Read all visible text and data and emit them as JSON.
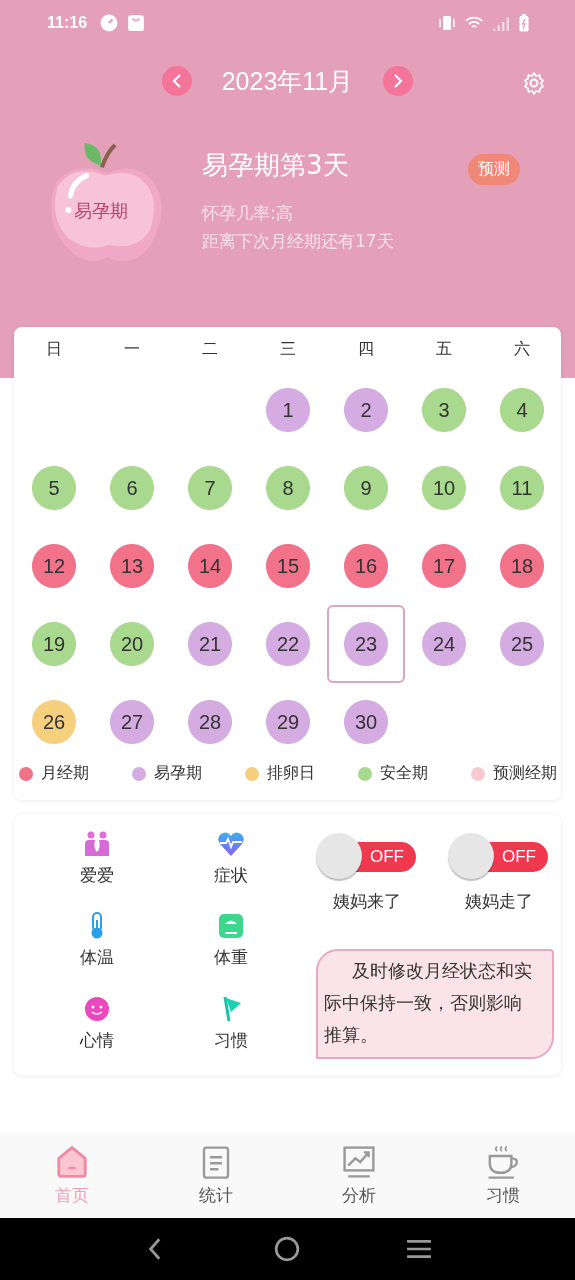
{
  "status_bar": {
    "time": "11:16"
  },
  "header": {
    "month": "2023年11月",
    "phase_badge": "易孕期",
    "phase_title": "易孕期第3天",
    "forecast_tag": "预测",
    "lines": [
      "怀孕几率:高",
      "距离下次月经期还有17天"
    ]
  },
  "calendar": {
    "weekdays": [
      "日",
      "一",
      "二",
      "三",
      "四",
      "五",
      "六"
    ],
    "weeks": [
      [
        {
          "kind": "blank"
        },
        {
          "kind": "blank"
        },
        {
          "kind": "blank"
        },
        {
          "kind": "day",
          "day": "1",
          "color": "#d4ace2",
          "selected": false
        },
        {
          "kind": "day",
          "day": "2",
          "color": "#d4ace2",
          "selected": false
        },
        {
          "kind": "day",
          "day": "3",
          "color": "#a8d98e",
          "selected": false
        },
        {
          "kind": "day",
          "day": "4",
          "color": "#a8d98e",
          "selected": false
        }
      ],
      [
        {
          "kind": "day",
          "day": "5",
          "color": "#a8d98e",
          "selected": false
        },
        {
          "kind": "day",
          "day": "6",
          "color": "#a8d98e",
          "selected": false
        },
        {
          "kind": "day",
          "day": "7",
          "color": "#a8d98e",
          "selected": false
        },
        {
          "kind": "day",
          "day": "8",
          "color": "#a8d98e",
          "selected": false
        },
        {
          "kind": "day",
          "day": "9",
          "color": "#a8d98e",
          "selected": false
        },
        {
          "kind": "day",
          "day": "10",
          "color": "#a8d98e",
          "selected": false
        },
        {
          "kind": "day",
          "day": "11",
          "color": "#a8d98e",
          "selected": false
        }
      ],
      [
        {
          "kind": "day",
          "day": "12",
          "color": "#f2728a",
          "selected": false
        },
        {
          "kind": "day",
          "day": "13",
          "color": "#f2728a",
          "selected": false
        },
        {
          "kind": "day",
          "day": "14",
          "color": "#f2728a",
          "selected": false
        },
        {
          "kind": "day",
          "day": "15",
          "color": "#f2728a",
          "selected": false
        },
        {
          "kind": "day",
          "day": "16",
          "color": "#f2728a",
          "selected": false
        },
        {
          "kind": "day",
          "day": "17",
          "color": "#f2728a",
          "selected": false
        },
        {
          "kind": "day",
          "day": "18",
          "color": "#f2728a",
          "selected": false
        }
      ],
      [
        {
          "kind": "day",
          "day": "19",
          "color": "#a8d98e",
          "selected": false
        },
        {
          "kind": "day",
          "day": "20",
          "color": "#a8d98e",
          "selected": false
        },
        {
          "kind": "day",
          "day": "21",
          "color": "#d4ace2",
          "selected": false
        },
        {
          "kind": "day",
          "day": "22",
          "color": "#d4ace2",
          "selected": false
        },
        {
          "kind": "day",
          "day": "23",
          "color": "#d4ace2",
          "selected": true
        },
        {
          "kind": "day",
          "day": "24",
          "color": "#d4ace2",
          "selected": false
        },
        {
          "kind": "day",
          "day": "25",
          "color": "#d4ace2",
          "selected": false
        }
      ],
      [
        {
          "kind": "day",
          "day": "26",
          "color": "#f6d07e",
          "selected": false
        },
        {
          "kind": "day",
          "day": "27",
          "color": "#d4ace2",
          "selected": false
        },
        {
          "kind": "day",
          "day": "28",
          "color": "#d4ace2",
          "selected": false
        },
        {
          "kind": "day",
          "day": "29",
          "color": "#d4ace2",
          "selected": false
        },
        {
          "kind": "day",
          "day": "30",
          "color": "#d4ace2",
          "selected": false
        },
        {
          "kind": "blank"
        },
        {
          "kind": "blank"
        }
      ]
    ],
    "legend": [
      {
        "label": "月经期",
        "color": "#f2728a"
      },
      {
        "label": "易孕期",
        "color": "#d4ace2"
      },
      {
        "label": "排卵日",
        "color": "#f6d07e"
      },
      {
        "label": "安全期",
        "color": "#a8d98e"
      },
      {
        "label": "预测经期",
        "color": "#f9c9d2"
      }
    ]
  },
  "tools": [
    "爱爱",
    "症状",
    "体温",
    "体重",
    "心情",
    "习惯"
  ],
  "toggles": [
    {
      "label": "OFF",
      "on": false,
      "caption": "姨妈来了"
    },
    {
      "label": "OFF",
      "on": false,
      "caption": "姨妈走了"
    }
  ],
  "tip": "及时修改月经状态和实际中保持一致，否则影响推算。",
  "bottom_nav": [
    {
      "label": "首页",
      "selected": true
    },
    {
      "label": "统计",
      "selected": false
    },
    {
      "label": "分析",
      "selected": false
    },
    {
      "label": "习惯",
      "selected": false
    }
  ]
}
